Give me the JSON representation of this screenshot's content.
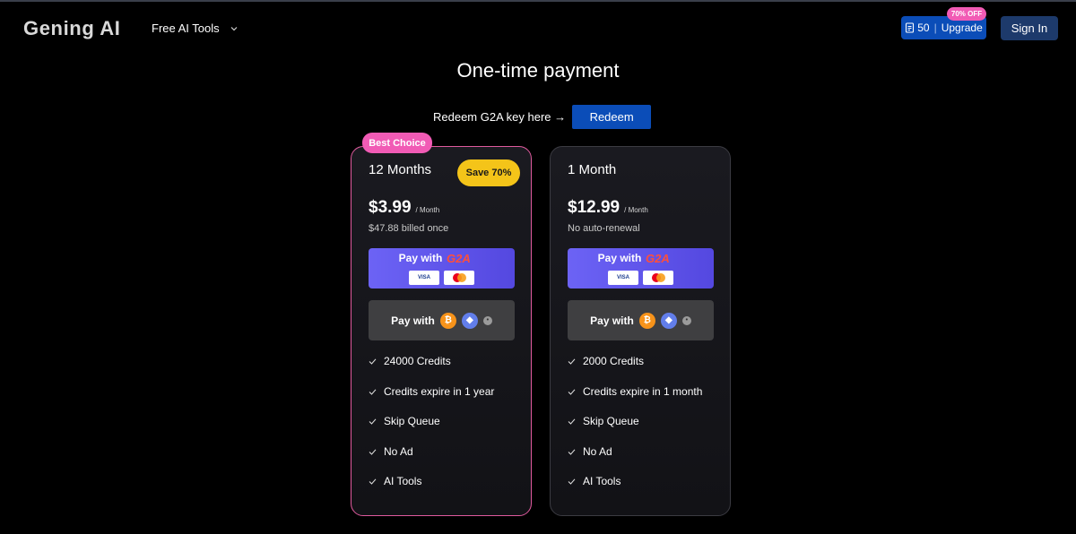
{
  "header": {
    "logo": "Gening AI",
    "nav_tools_label": "Free AI Tools",
    "credits": "50",
    "upgrade_label": "Upgrade",
    "upgrade_badge": "70% OFF",
    "signin_label": "Sign In"
  },
  "page_title": "One-time payment",
  "redeem": {
    "text": "Redeem G2A key here →",
    "button_label": "Redeem"
  },
  "plans": [
    {
      "badge": "Best Choice",
      "name": "12 Months",
      "save_badge": "Save 70%",
      "price": "$3.99",
      "price_unit": "/ Month",
      "billing": "$47.88 billed once",
      "pay_g2a_label": "Pay with",
      "pay_crypto_label": "Pay with",
      "features": [
        "24000 Credits",
        "Credits expire in 1 year",
        "Skip Queue",
        "No Ad",
        "AI Tools"
      ]
    },
    {
      "name": "1 Month",
      "price": "$12.99",
      "price_unit": "/ Month",
      "billing": "No auto-renewal",
      "pay_g2a_label": "Pay with",
      "pay_crypto_label": "Pay with",
      "features": [
        "2000 Credits",
        "Credits expire in 1 month",
        "Skip Queue",
        "No Ad",
        "AI Tools"
      ]
    }
  ],
  "payment_logos": {
    "g2a": "G2A",
    "visa": "VISA"
  },
  "icons": {
    "nav_chevron": "chevron-down-icon",
    "credits": "document-icon",
    "check": "check-icon",
    "bitcoin": "bitcoin-icon",
    "ethereum": "ethereum-icon",
    "crypto_other": "coin-icon"
  },
  "colors": {
    "background": "#000000",
    "primary_blue": "#0b4db8",
    "signin_blue": "#1d3a6b",
    "pink": "#f15bb5",
    "save_yellow": "#f4c419",
    "g2a_purple": "#6c63f5",
    "crypto_gray": "#3f3f41"
  }
}
